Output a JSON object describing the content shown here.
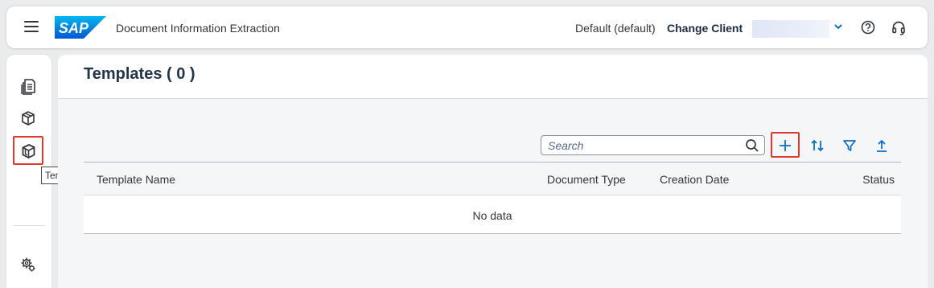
{
  "shell": {
    "app_title": "Document Information Extraction",
    "client_label": "Default (default)",
    "change_client": "Change Client",
    "client_value": "",
    "logo_text": "SAP"
  },
  "sidenav": {
    "items": [
      {
        "name": "documents",
        "icon": "documents-icon"
      },
      {
        "name": "schemas",
        "icon": "cube-icon"
      },
      {
        "name": "template",
        "icon": "template-cube-icon",
        "tooltip": "Template",
        "selected": true
      },
      {
        "name": "settings",
        "icon": "gears-icon"
      }
    ]
  },
  "main": {
    "title": "Templates ( 0 )",
    "search": {
      "placeholder": "Search",
      "value": ""
    },
    "toolbar": {
      "icons": [
        "add-icon",
        "sort-icon",
        "filter-icon",
        "export-icon"
      ]
    },
    "table": {
      "columns": [
        "Template Name",
        "Document Type",
        "Creation Date",
        "Status"
      ],
      "rows": [],
      "empty_text": "No data"
    }
  },
  "colors": {
    "accent": "#0a6ed1",
    "highlight": "#e0372f",
    "sap_blue": "#0a76d8"
  }
}
